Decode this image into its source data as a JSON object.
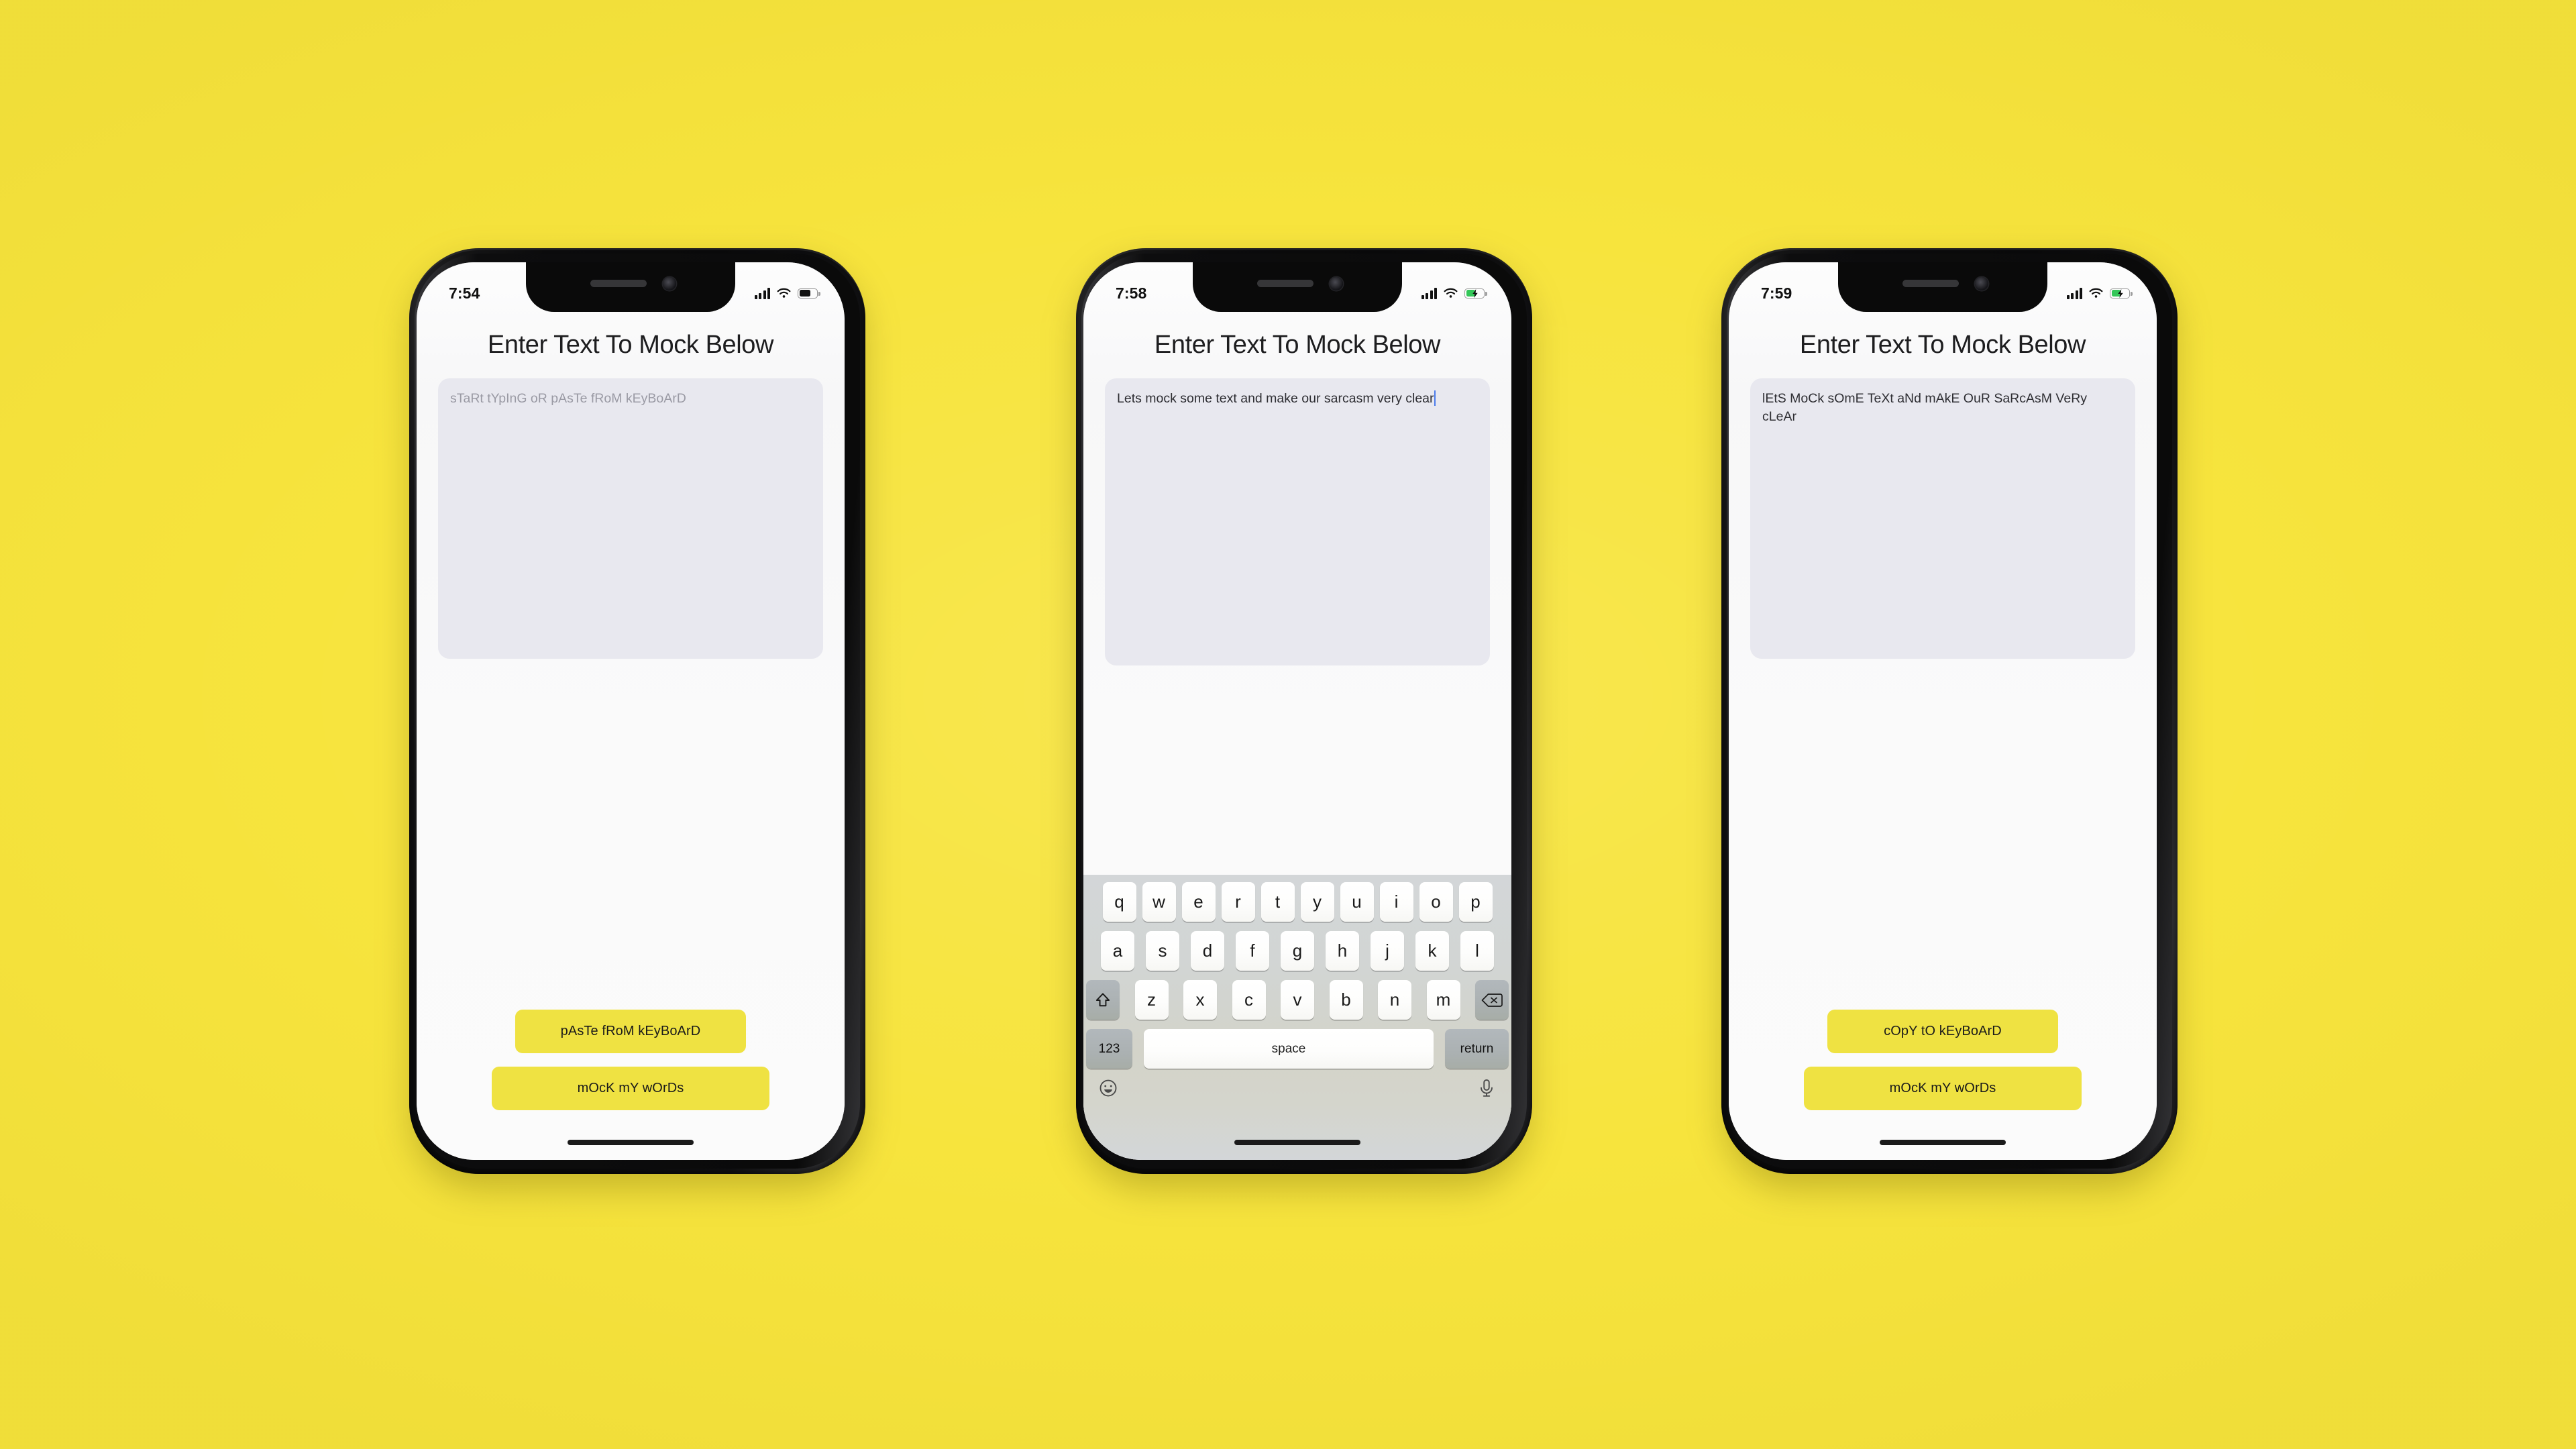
{
  "background": {
    "color": "#F7E43D"
  },
  "theme": {
    "button_yellow": "#EFE242",
    "textarea_bg": "#E8E8EF",
    "caret_color": "#4B7BEC",
    "battery_green": "#34C759"
  },
  "phones": [
    {
      "id": "phone-1",
      "status": {
        "time": "7:54",
        "signal": "signal-icon",
        "wifi": "wifi-icon",
        "battery": "battery-icon",
        "charging": false
      },
      "title": "Enter Text To Mock Below",
      "textarea": {
        "placeholder": "sTaRt tYpInG oR pAsTe fRoM kEyBoArD",
        "value": "",
        "has_caret": false
      },
      "buttons": {
        "primary": "pAsTe fRoM kEyBoArD",
        "secondary": "mOcK mY wOrDs"
      },
      "keyboard_visible": false
    },
    {
      "id": "phone-2",
      "status": {
        "time": "7:58",
        "signal": "signal-icon",
        "wifi": "wifi-icon",
        "battery": "battery-charging-icon",
        "charging": true
      },
      "title": "Enter Text To Mock Below",
      "textarea": {
        "placeholder": "sTaRt tYpInG oR pAsTe fRoM kEyBoArD",
        "value": "Lets mock some text and make our sarcasm very clear",
        "has_caret": true
      },
      "buttons": {
        "primary": "pAsTe fRoM kEyBoArD",
        "secondary": "mOcK mY wOrDs"
      },
      "keyboard_visible": true
    },
    {
      "id": "phone-3",
      "status": {
        "time": "7:59",
        "signal": "signal-icon",
        "wifi": "wifi-icon",
        "battery": "battery-charging-icon",
        "charging": true
      },
      "title": "Enter Text To Mock Below",
      "textarea": {
        "placeholder": "sTaRt tYpInG oR pAsTe fRoM kEyBoArD",
        "value": "lEtS MoCk sOmE TeXt aNd mAkE OuR SaRcAsM VeRy cLeAr",
        "has_caret": false
      },
      "buttons": {
        "primary": "cOpY tO kEyBoArD",
        "secondary": "mOcK mY wOrDs"
      },
      "keyboard_visible": false
    }
  ],
  "keyboard": {
    "row1": [
      "q",
      "w",
      "e",
      "r",
      "t",
      "y",
      "u",
      "i",
      "o",
      "p"
    ],
    "row2": [
      "a",
      "s",
      "d",
      "f",
      "g",
      "h",
      "j",
      "k",
      "l"
    ],
    "row3": [
      "z",
      "x",
      "c",
      "v",
      "b",
      "n",
      "m"
    ],
    "shift_key": "shift-icon",
    "delete_key": "backspace-icon",
    "numeric_key": "123",
    "space_key": "space",
    "return_key": "return",
    "emoji_key": "emoji-icon",
    "dictation_key": "microphone-icon"
  }
}
